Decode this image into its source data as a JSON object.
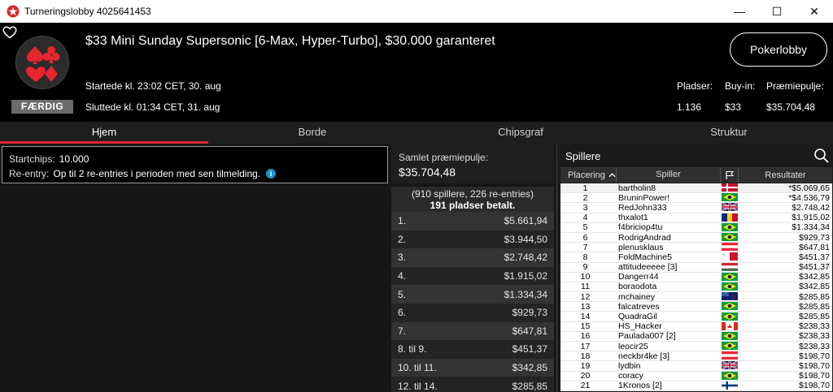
{
  "window": {
    "title": "Turneringslobby 4025641453",
    "minimize": "—",
    "maximize": "☐",
    "close": "✕"
  },
  "header": {
    "tournament_name": "$33 Mini Sunday Supersonic [6-Max, Hyper-Turbo], $30.000 garanteret",
    "started": "Startede kl. 23:02 CET, 30. aug",
    "ended": "Sluttede kl. 01:34 CET, 31. aug",
    "status_badge": "FÆRDIG",
    "lobby_button": "Pokerlobby",
    "stats": [
      {
        "label": "Pladser:",
        "value": "1.136"
      },
      {
        "label": "Buy-in:",
        "value": "$33"
      },
      {
        "label": "Præmiepulje:",
        "value": "$35.704,48"
      }
    ]
  },
  "tabs": [
    {
      "label": "Hjem",
      "active": true
    },
    {
      "label": "Borde",
      "active": false
    },
    {
      "label": "Chipsgraf",
      "active": false
    },
    {
      "label": "Struktur",
      "active": false
    }
  ],
  "info": {
    "startchips_label": "Startchips:",
    "startchips_value": "10.000",
    "reentry_label": "Re-entry:",
    "reentry_value": "Op til 2 re-entries i perioden med sen tilmelding."
  },
  "prizes": {
    "pool_label": "Samlet præmiepulje:",
    "pool_value": "$35.704,48",
    "entries": "(910 spillere, 226 re-entries)",
    "paid": "191 pladser betalt.",
    "rows": [
      {
        "place": "1.",
        "amount": "$5.661,94"
      },
      {
        "place": "2.",
        "amount": "$3.944,50"
      },
      {
        "place": "3.",
        "amount": "$2.748,42"
      },
      {
        "place": "4.",
        "amount": "$1.915,02"
      },
      {
        "place": "5.",
        "amount": "$1.334,34"
      },
      {
        "place": "6.",
        "amount": "$929,73"
      },
      {
        "place": "7.",
        "amount": "$647,81"
      },
      {
        "place": "8. til 9.",
        "amount": "$451,37"
      },
      {
        "place": "10. til 11.",
        "amount": "$342,85"
      },
      {
        "place": "12. til 14.",
        "amount": "$285,85"
      }
    ]
  },
  "players": {
    "title": "Spillere",
    "columns": {
      "place": "Placering",
      "player": "Spiller",
      "results": "Resultater"
    },
    "rows": [
      {
        "place": "1",
        "name": "bartholin8",
        "flag": "dk",
        "result": "*$5.069,65"
      },
      {
        "place": "2",
        "name": "BruninPower!",
        "flag": "br",
        "result": "*$4.536,79"
      },
      {
        "place": "3",
        "name": "RedJohn333",
        "flag": "gb",
        "result": "$2.748,42"
      },
      {
        "place": "4",
        "name": "thxalot1",
        "flag": "ro",
        "result": "$1.915,02"
      },
      {
        "place": "5",
        "name": "f4briciop4tu",
        "flag": "br",
        "result": "$1.334,34"
      },
      {
        "place": "6",
        "name": "RodrigAndrad",
        "flag": "br",
        "result": "$929,73"
      },
      {
        "place": "7",
        "name": "plenusklaus",
        "flag": "at",
        "result": "$647,81"
      },
      {
        "place": "8",
        "name": "FoldMachine5",
        "flag": "mt",
        "result": "$451,37"
      },
      {
        "place": "9",
        "name": "attitudeeeee [3]",
        "flag": "hu",
        "result": "$451,37"
      },
      {
        "place": "10",
        "name": "Dangerr44",
        "flag": "br",
        "result": "$342,85"
      },
      {
        "place": "11",
        "name": "boraodota",
        "flag": "br",
        "result": "$342,85"
      },
      {
        "place": "12",
        "name": "mchainey",
        "flag": "nz",
        "result": "$285,85"
      },
      {
        "place": "13",
        "name": "falcatreves",
        "flag": "br",
        "result": "$285,85"
      },
      {
        "place": "14",
        "name": "QuadraGil",
        "flag": "br",
        "result": "$285,85"
      },
      {
        "place": "15",
        "name": "HS_Hacker",
        "flag": "ca",
        "result": "$238,33"
      },
      {
        "place": "16",
        "name": "Paulada007 [2]",
        "flag": "br",
        "result": "$238,33"
      },
      {
        "place": "17",
        "name": "leocir25",
        "flag": "br",
        "result": "$238,33"
      },
      {
        "place": "18",
        "name": "neckbr4ke [3]",
        "flag": "at",
        "result": "$198,70"
      },
      {
        "place": "19",
        "name": "lydbin",
        "flag": "gb",
        "result": "$198,70"
      },
      {
        "place": "20",
        "name": "coracy",
        "flag": "br",
        "result": "$198,70"
      },
      {
        "place": "21",
        "name": "1Kronos [2]",
        "flag": "fi",
        "result": "$198,70"
      }
    ]
  },
  "colors": {
    "accent_red": "#d9262d",
    "info_blue": "#1b93d1"
  }
}
